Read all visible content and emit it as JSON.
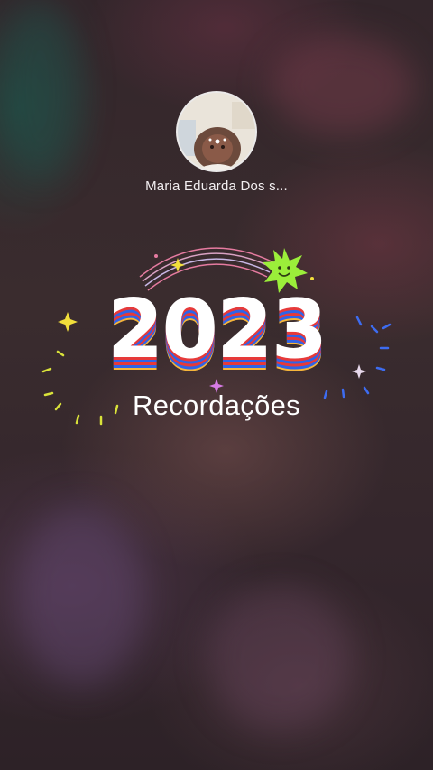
{
  "contact": {
    "name": "Maria Eduarda Dos s..."
  },
  "card": {
    "year": "2023",
    "subtitle": "Recordações"
  },
  "icons": {
    "avatar": "profile-photo",
    "smiley_star": "smiley-star-icon",
    "sparkles": "sparkle-icon"
  },
  "colors": {
    "smiley_star": "#9bee3a",
    "year_red": "#e63a3a",
    "year_blue": "#2f63e8",
    "year_yellow": "#f6b53a"
  }
}
